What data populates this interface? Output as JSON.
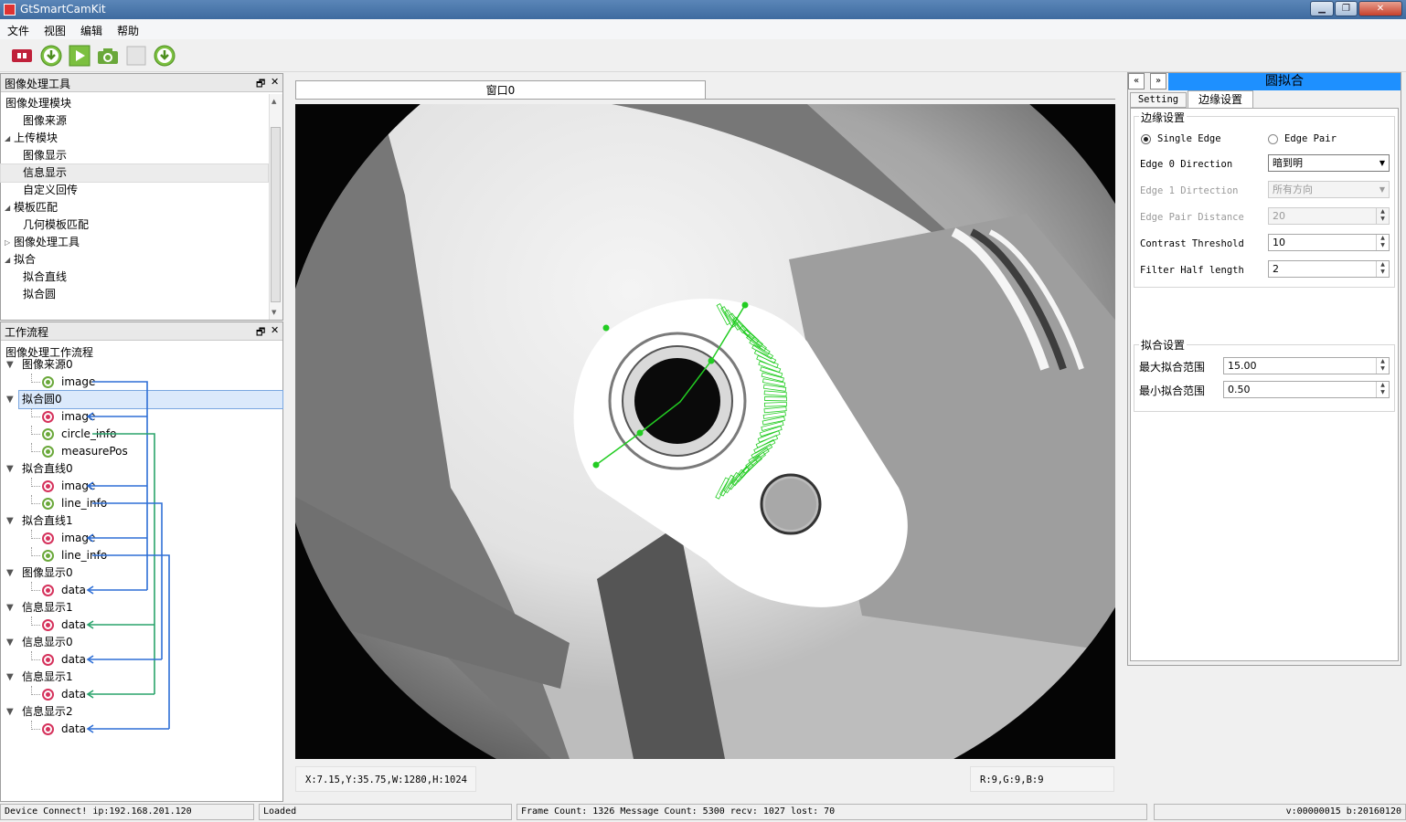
{
  "app": {
    "title": "GtSmartCamKit"
  },
  "menu": [
    "文件",
    "视图",
    "编辑",
    "帮助"
  ],
  "toolbar": {
    "icons": [
      "stop-connect-icon",
      "download-icon",
      "run-icon",
      "camera-icon",
      "blank-icon",
      "upload-icon"
    ]
  },
  "tools_panel": {
    "title": "图像处理工具",
    "items": [
      {
        "label": "图像处理模块",
        "level": 0
      },
      {
        "label": "图像来源",
        "level": 1
      },
      {
        "label": "上传模块",
        "level": 0,
        "expand": "open"
      },
      {
        "label": "图像显示",
        "level": 1
      },
      {
        "label": "信息显示",
        "level": 1,
        "selected": true
      },
      {
        "label": "自定义回传",
        "level": 1
      },
      {
        "label": "模板匹配",
        "level": 0,
        "expand": "open"
      },
      {
        "label": "几何模板匹配",
        "level": 1
      },
      {
        "label": "图像处理工具",
        "level": 0,
        "expand": "closed"
      },
      {
        "label": "拟合",
        "level": 0,
        "expand": "open"
      },
      {
        "label": "拟合直线",
        "level": 1
      },
      {
        "label": "拟合圆",
        "level": 1
      }
    ]
  },
  "workflow_panel": {
    "title": "工作流程",
    "subtitle": "图像处理工作流程",
    "nodes": [
      {
        "label": "图像来源0",
        "type": "node"
      },
      {
        "label": "image",
        "type": "out"
      },
      {
        "label": "拟合圆0",
        "type": "node",
        "selected": true
      },
      {
        "label": "image",
        "type": "in"
      },
      {
        "label": "circle_info",
        "type": "out"
      },
      {
        "label": "measurePos",
        "type": "out"
      },
      {
        "label": "拟合直线0",
        "type": "node"
      },
      {
        "label": "image",
        "type": "in"
      },
      {
        "label": "line_info",
        "type": "out"
      },
      {
        "label": "拟合直线1",
        "type": "node"
      },
      {
        "label": "image",
        "type": "in"
      },
      {
        "label": "line_info",
        "type": "out"
      },
      {
        "label": "图像显示0",
        "type": "node"
      },
      {
        "label": "data",
        "type": "in"
      },
      {
        "label": "信息显示1",
        "type": "node"
      },
      {
        "label": "data",
        "type": "in"
      },
      {
        "label": "信息显示0",
        "type": "node"
      },
      {
        "label": "data",
        "type": "in"
      },
      {
        "label": "信息显示1",
        "type": "node"
      },
      {
        "label": "data",
        "type": "in"
      },
      {
        "label": "信息显示2",
        "type": "node"
      },
      {
        "label": "data",
        "type": "in"
      }
    ]
  },
  "viewer": {
    "tab": "窗口0",
    "coords": "X:7.15,Y:35.75,W:1280,H:1024",
    "rgb": "R:9,G:9,B:9"
  },
  "right_panel": {
    "title": "圆拟合",
    "tabs": [
      "Setting",
      "边缘设置"
    ],
    "active_tab": "边缘设置",
    "edge_group": "边缘设置",
    "single_edge": "Single Edge",
    "edge_pair": "Edge Pair",
    "edge0_direction_label": "Edge 0 Direction",
    "edge0_direction_value": "暗到明",
    "edge1_direction_label": "Edge 1 Dirtection",
    "edge1_direction_value": "所有方向",
    "edge_pair_distance_label": "Edge Pair Distance",
    "edge_pair_distance_value": "20",
    "contrast_label": "Contrast Threshold",
    "contrast_value": "10",
    "filter_label": "Filter Half length",
    "filter_value": "2",
    "fit_group": "拟合设置",
    "max_range_label": "最大拟合范围",
    "max_range_value": "15.00",
    "min_range_label": "最小拟合范围",
    "min_range_value": "0.50"
  },
  "statusbar": {
    "device": "Device Connect! ip:192.168.201.120",
    "loaded": "Loaded",
    "frames": "Frame Count: 1326 Message Count: 5300  recv: 1027  lost: 70",
    "version": "v:00000015 b:20160120"
  },
  "colors": {
    "accent_blue": "#1e90ff",
    "title_blue": "#3e6b9f",
    "fit_green": "#22cc22",
    "link_blue": "#2f6fd6",
    "link_green": "#2aa36b"
  }
}
